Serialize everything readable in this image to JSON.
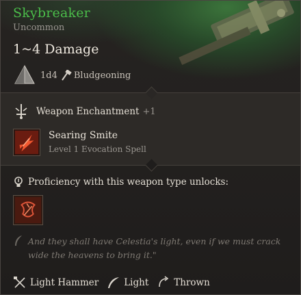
{
  "item": {
    "name": "Skybreaker",
    "rarity": "Uncommon",
    "damage": "1~4 Damage",
    "dice": "1d4",
    "damage_type": "Bludgeoning"
  },
  "enchantment": {
    "label": "Weapon Enchantment",
    "bonus": "+1"
  },
  "spell": {
    "name": "Searing Smite",
    "description": "Level 1 Evocation Spell",
    "icon": "searing-smite-icon"
  },
  "proficiency": {
    "label": "Proficiency with this weapon type unlocks:",
    "icon": "weapon-action-icon"
  },
  "quote": "And they shall have Celestia's light, even if we must crack wide the heavens to bring it.\"",
  "properties": [
    {
      "label": "Light Hammer",
      "icon": "light-hammer-icon"
    },
    {
      "label": "Light",
      "icon": "feather-icon"
    },
    {
      "label": "Thrown",
      "icon": "thrown-icon"
    }
  ],
  "colors": {
    "rarity_green": "#4bbd4a",
    "text_primary": "#efe9df",
    "text_muted": "#9a9690",
    "background": "#1f1d1c"
  }
}
